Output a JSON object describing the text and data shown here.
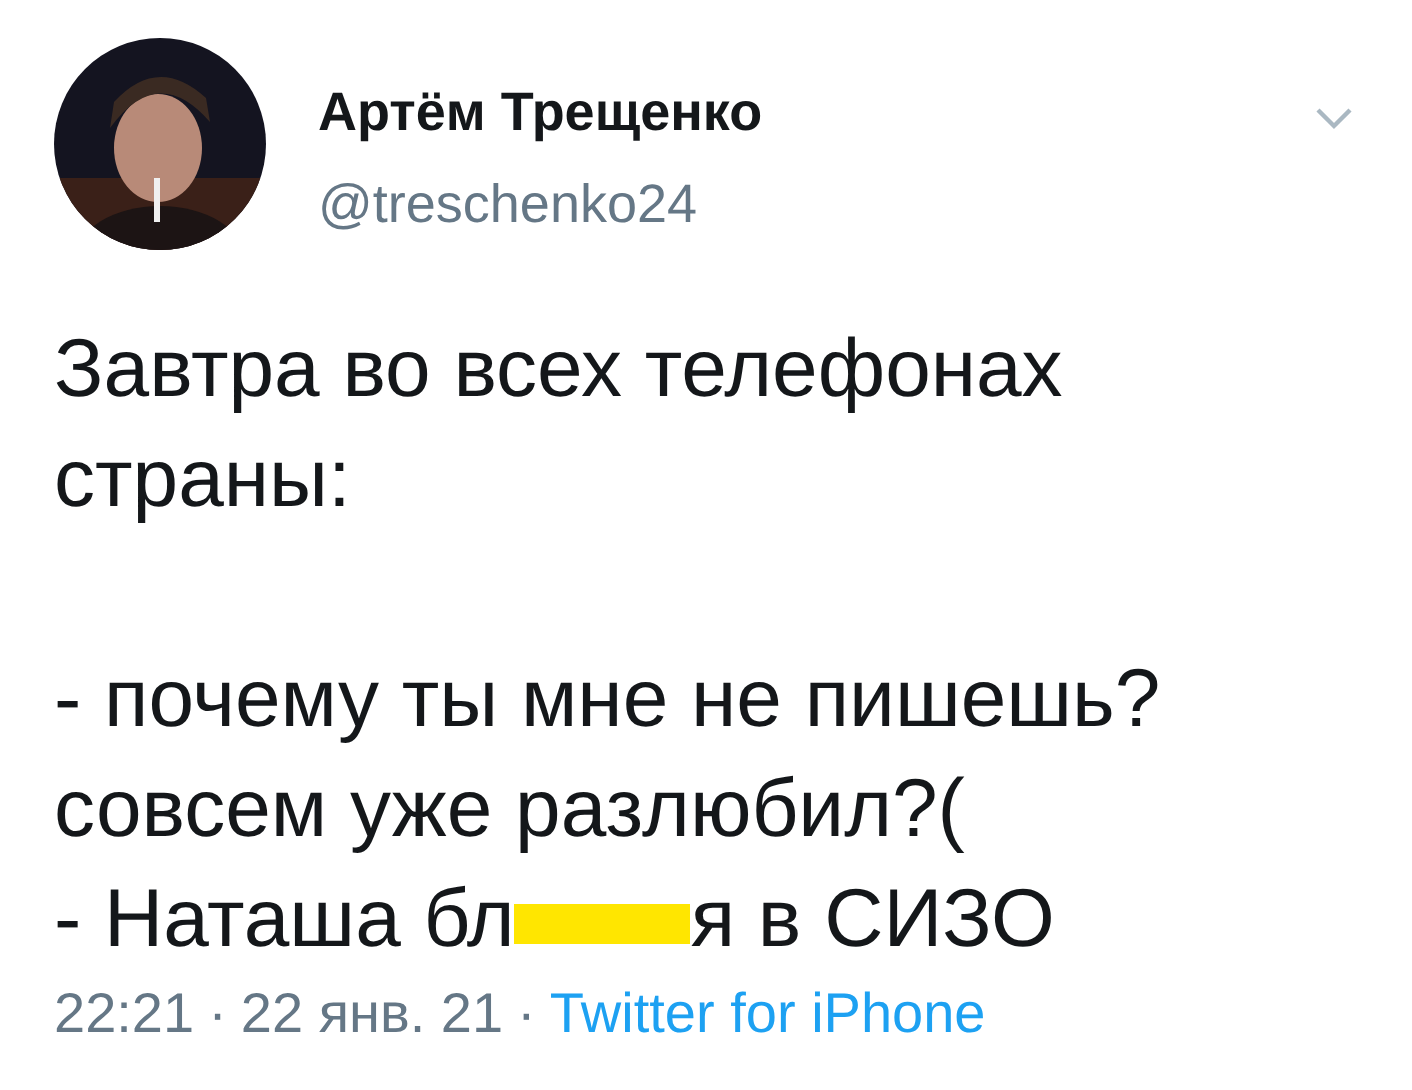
{
  "author": {
    "name": "Артём Трещенко",
    "handle": "@treschenko24"
  },
  "body": [
    {
      "kind": "text",
      "text": "Завтра во всех телефонах"
    },
    {
      "kind": "text",
      "text": "страны:"
    },
    {
      "kind": "blank"
    },
    {
      "kind": "text",
      "text": "- почему ты мне не пишешь?"
    },
    {
      "kind": "text",
      "text": "совсем уже разлюбил?("
    },
    {
      "kind": "redacted",
      "before": "- Наташа бл",
      "after": "я в СИЗО"
    }
  ],
  "footer": {
    "time": "22:21",
    "separator_1": "·",
    "date": "22 янв. 21",
    "separator_2": "·",
    "source": "Twitter for iPhone"
  }
}
